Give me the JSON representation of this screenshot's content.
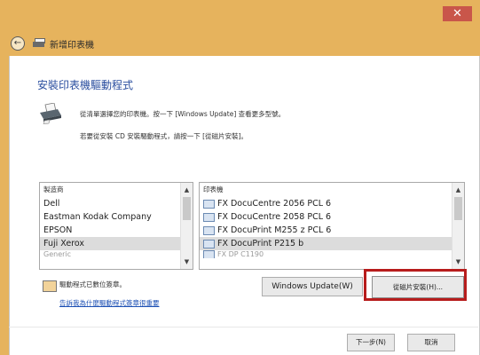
{
  "window": {
    "close_label": "✕"
  },
  "nav": {
    "title": "新增印表機"
  },
  "page": {
    "heading": "安裝印表機驅動程式",
    "description_line1": "從清單選擇您的印表機。按一下 [Windows Update] 查看更多型號。",
    "description_line2": "若要從安裝 CD 安裝驅動程式，請按一下 [從磁片安裝]。"
  },
  "manufacturer_list": {
    "header": "製造商",
    "items": [
      "Dell",
      "Eastman Kodak Company",
      "EPSON",
      "Fuji Xerox",
      "Generic"
    ],
    "selected": "Fuji Xerox"
  },
  "printer_list": {
    "header": "印表機",
    "items": [
      "FX DocuCentre 2056 PCL 6",
      "FX DocuCentre 2058 PCL 6",
      "FX DocuPrint M255 z PCL 6",
      "FX DocuPrint P215 b",
      "FX DP C1190"
    ],
    "selected": "FX DocuPrint P215 b"
  },
  "signed": {
    "text": "驅動程式已數位簽章。",
    "link": "告訴我為什麼驅動程式簽章很重要"
  },
  "buttons": {
    "windows_update": "Windows Update(W)",
    "have_disk": "從磁片安裝(H)...",
    "next": "下一步(N)",
    "cancel": "取消"
  },
  "colors": {
    "titlebar": "#e6b35d",
    "heading": "#2a4e9f",
    "highlight_border": "#b71c1c",
    "link": "#1d50b4"
  }
}
